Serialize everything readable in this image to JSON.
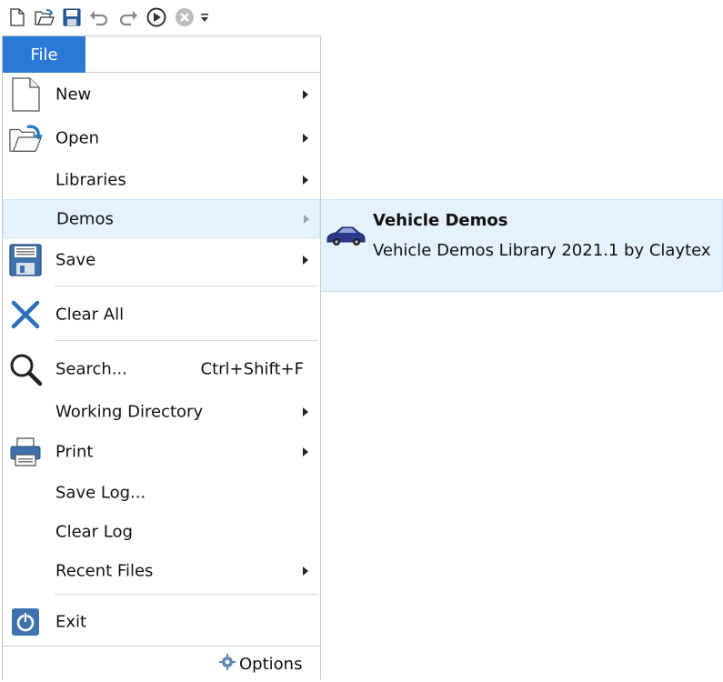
{
  "toolbar": {
    "icons": [
      "new-icon",
      "open-icon",
      "save-icon",
      "undo-icon",
      "redo-icon",
      "run-icon",
      "stop-icon",
      "customize-dropdown-icon"
    ]
  },
  "file_tab": {
    "label": "File"
  },
  "menu": {
    "items": [
      {
        "label": "New",
        "icon": "new-document-icon",
        "submenu": true
      },
      {
        "label": "Open",
        "icon": "open-folder-icon",
        "submenu": true
      },
      {
        "label": "Libraries",
        "submenu": true
      },
      {
        "label": "Demos",
        "submenu": true,
        "highlighted": true
      },
      {
        "label": "Save",
        "icon": "save-disk-icon",
        "submenu": true
      },
      {
        "label": "Clear All",
        "icon": "clear-all-icon"
      },
      {
        "label": "Search...",
        "icon": "search-icon",
        "shortcut": "Ctrl+Shift+F"
      },
      {
        "label": "Working Directory",
        "submenu": true
      },
      {
        "label": "Print",
        "icon": "printer-icon",
        "submenu": true
      },
      {
        "label": "Save Log..."
      },
      {
        "label": "Clear Log"
      },
      {
        "label": "Recent Files",
        "submenu": true
      },
      {
        "label": "Exit",
        "icon": "exit-power-icon"
      }
    ],
    "options_label": "Options"
  },
  "demos_submenu": {
    "items": [
      {
        "title": "Vehicle Demos",
        "description": "Vehicle Demos Library 2021.1 by Claytex",
        "icon": "car-icon"
      }
    ]
  },
  "colors": {
    "accent": "#2b79d7",
    "highlight_bg": "#e5f1fb",
    "highlight_border": "#cde4f7"
  }
}
